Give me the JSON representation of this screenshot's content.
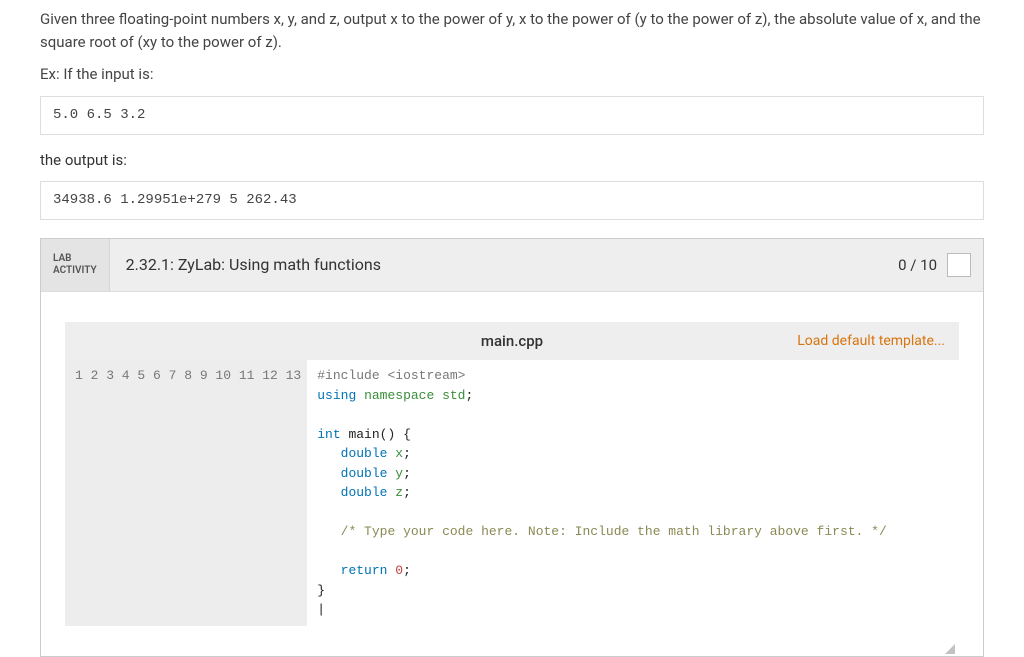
{
  "problem": {
    "p1": "Given three floating-point numbers x, y, and z, output x to the power of y, x to the power of (y to the power of z), the absolute value of x, and the square root of (xy to the power of z).",
    "p2": "Ex: If the input is:",
    "input_example": "5.0 6.5 3.2",
    "p3": "the output is:",
    "output_example": "34938.6 1.29951e+279 5 262.43"
  },
  "lab": {
    "badge_l1": "LAB",
    "badge_l2": "ACTIVITY",
    "title": "2.32.1: ZyLab: Using math functions",
    "score": "0 / 10"
  },
  "editor": {
    "filename": "main.cpp",
    "load_template": "Load default template...",
    "line_count": 13,
    "code_tokens": [
      [
        [
          "pre",
          "#include "
        ],
        [
          "inc",
          "<iostream>"
        ]
      ],
      [
        [
          "kw",
          "using "
        ],
        [
          "ns",
          "namespace"
        ],
        [
          "id",
          " std"
        ],
        [
          "op",
          ";"
        ]
      ],
      [],
      [
        [
          "type",
          "int"
        ],
        [
          "op",
          " main"
        ],
        [
          "op",
          "() {"
        ]
      ],
      [
        [
          "op",
          "   "
        ],
        [
          "type",
          "double"
        ],
        [
          "id",
          " x"
        ],
        [
          "op",
          ";"
        ]
      ],
      [
        [
          "op",
          "   "
        ],
        [
          "type",
          "double"
        ],
        [
          "id",
          " y"
        ],
        [
          "op",
          ";"
        ]
      ],
      [
        [
          "op",
          "   "
        ],
        [
          "type",
          "double"
        ],
        [
          "id",
          " z"
        ],
        [
          "op",
          ";"
        ]
      ],
      [],
      [
        [
          "op",
          "   "
        ],
        [
          "cm",
          "/* Type your code here. Note: Include the math library above first. */"
        ]
      ],
      [],
      [
        [
          "op",
          "   "
        ],
        [
          "kw",
          "return "
        ],
        [
          "num",
          "0"
        ],
        [
          "op",
          ";"
        ]
      ],
      [
        [
          "op",
          "}"
        ]
      ],
      [
        [
          "op",
          "|"
        ]
      ]
    ]
  }
}
